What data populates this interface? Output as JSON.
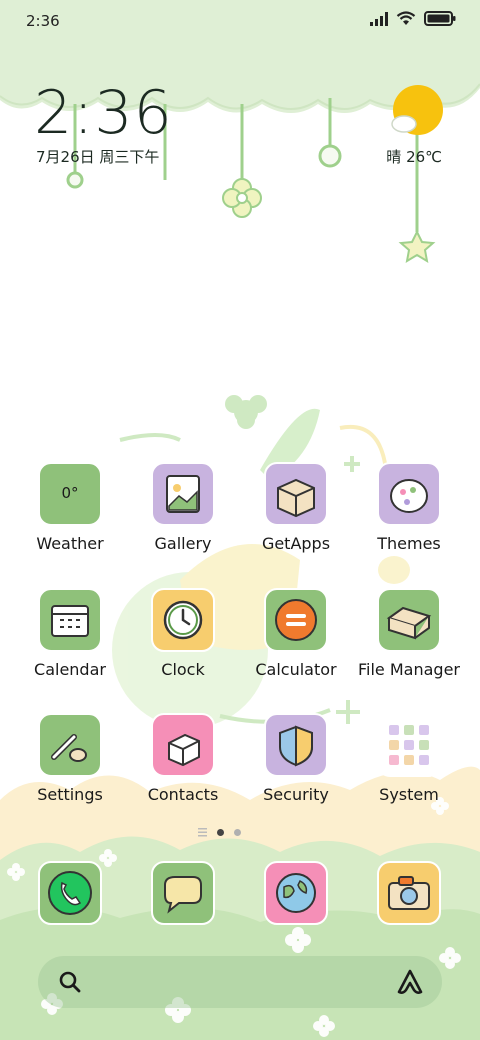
{
  "status_bar": {
    "time": "2:36"
  },
  "clock": {
    "time": "2:36",
    "date": "7月26日 周三下午"
  },
  "weather": {
    "condition": "晴",
    "temperature": "26℃"
  },
  "apps": [
    {
      "label": "Weather",
      "icon": "weather-icon",
      "color": "#8fc17a",
      "text": "0°"
    },
    {
      "label": "Gallery",
      "icon": "gallery-icon",
      "color": "#c8b3df"
    },
    {
      "label": "GetApps",
      "icon": "getapps-icon",
      "color": "#c8b3df"
    },
    {
      "label": "Themes",
      "icon": "themes-icon",
      "color": "#c8b3df"
    },
    {
      "label": "Calendar",
      "icon": "calendar-icon",
      "color": "#8fc17a"
    },
    {
      "label": "Clock",
      "icon": "clock-icon",
      "color": "#f7cd6e"
    },
    {
      "label": "Calculator",
      "icon": "calculator-icon",
      "color": "#8fc17a"
    },
    {
      "label": "File Manager",
      "icon": "file-manager-icon",
      "color": "#8fc17a"
    },
    {
      "label": "Settings",
      "icon": "settings-icon",
      "color": "#8fc17a"
    },
    {
      "label": "Contacts",
      "icon": "contacts-icon",
      "color": "#f58fb7"
    },
    {
      "label": "Security",
      "icon": "security-icon",
      "color": "#c8b3df"
    },
    {
      "label": "System",
      "icon": "system-folder-icon",
      "color": "#ffffff"
    }
  ],
  "dock": [
    {
      "name": "phone",
      "icon": "phone-icon",
      "color": "#8fc17a"
    },
    {
      "name": "messages",
      "icon": "message-icon",
      "color": "#8fc17a"
    },
    {
      "name": "browser",
      "icon": "globe-icon",
      "color": "#f58fb7"
    },
    {
      "name": "camera",
      "icon": "camera-icon",
      "color": "#f7cd6e"
    }
  ]
}
